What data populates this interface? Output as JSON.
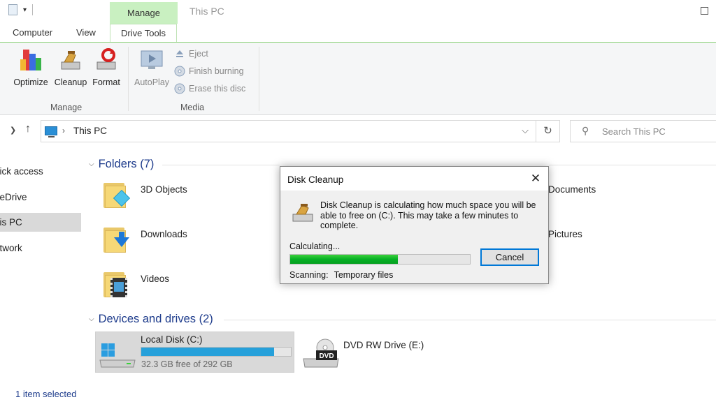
{
  "title_bar": {
    "contextual_tab": "Manage",
    "window_title": "This PC"
  },
  "ribbon_tabs": {
    "computer": "Computer",
    "view": "View",
    "drive_tools": "Drive Tools"
  },
  "ribbon": {
    "manage_group": {
      "label": "Manage",
      "optimize": "Optimize",
      "cleanup": "Cleanup",
      "format": "Format"
    },
    "media_group": {
      "label": "Media",
      "autoplay": "AutoPlay",
      "eject": "Eject",
      "finish_burning": "Finish burning",
      "erase_disc": "Erase this disc"
    }
  },
  "address_bar": {
    "breadcrumb": "This PC",
    "search_placeholder": "Search This PC"
  },
  "nav_pane": {
    "items": [
      "Quick access",
      "OneDrive",
      "This PC",
      "Network"
    ],
    "visible_text": [
      "uick access",
      "neDrive",
      "his PC",
      "etwork"
    ],
    "selected": "This PC"
  },
  "sections": {
    "folders": {
      "header": "Folders (7)",
      "items": [
        "3D Objects",
        "Documents",
        "Downloads",
        "Pictures",
        "Videos"
      ],
      "visible_right": [
        "Documents",
        "Pictures"
      ]
    },
    "devices": {
      "header": "Devices and drives (2)",
      "local_disk": {
        "name": "Local Disk (C:)",
        "free_text": "32.3 GB free of 292 GB",
        "used_fraction": 0.89
      },
      "dvd_drive": {
        "name": "DVD RW Drive (E:)",
        "badge": "DVD"
      }
    }
  },
  "status_bar": {
    "text": "1 item selected"
  },
  "dialog": {
    "title": "Disk Cleanup",
    "message": "Disk Cleanup is calculating how much space you will be able to free on  (C:). This may take a few minutes to complete.",
    "calculating_label": "Calculating...",
    "progress_fraction": 0.6,
    "scanning_label": "Scanning:",
    "scanning_value": "Temporary files",
    "cancel_label": "Cancel",
    "close_glyph": "✕"
  },
  "colors": {
    "context_tab_bg": "#c9f0c1",
    "progress_green": "#06b025",
    "drive_bar_blue": "#26a0da",
    "section_header_blue": "#1e3c8c",
    "button_focus_border": "#0078d7"
  }
}
